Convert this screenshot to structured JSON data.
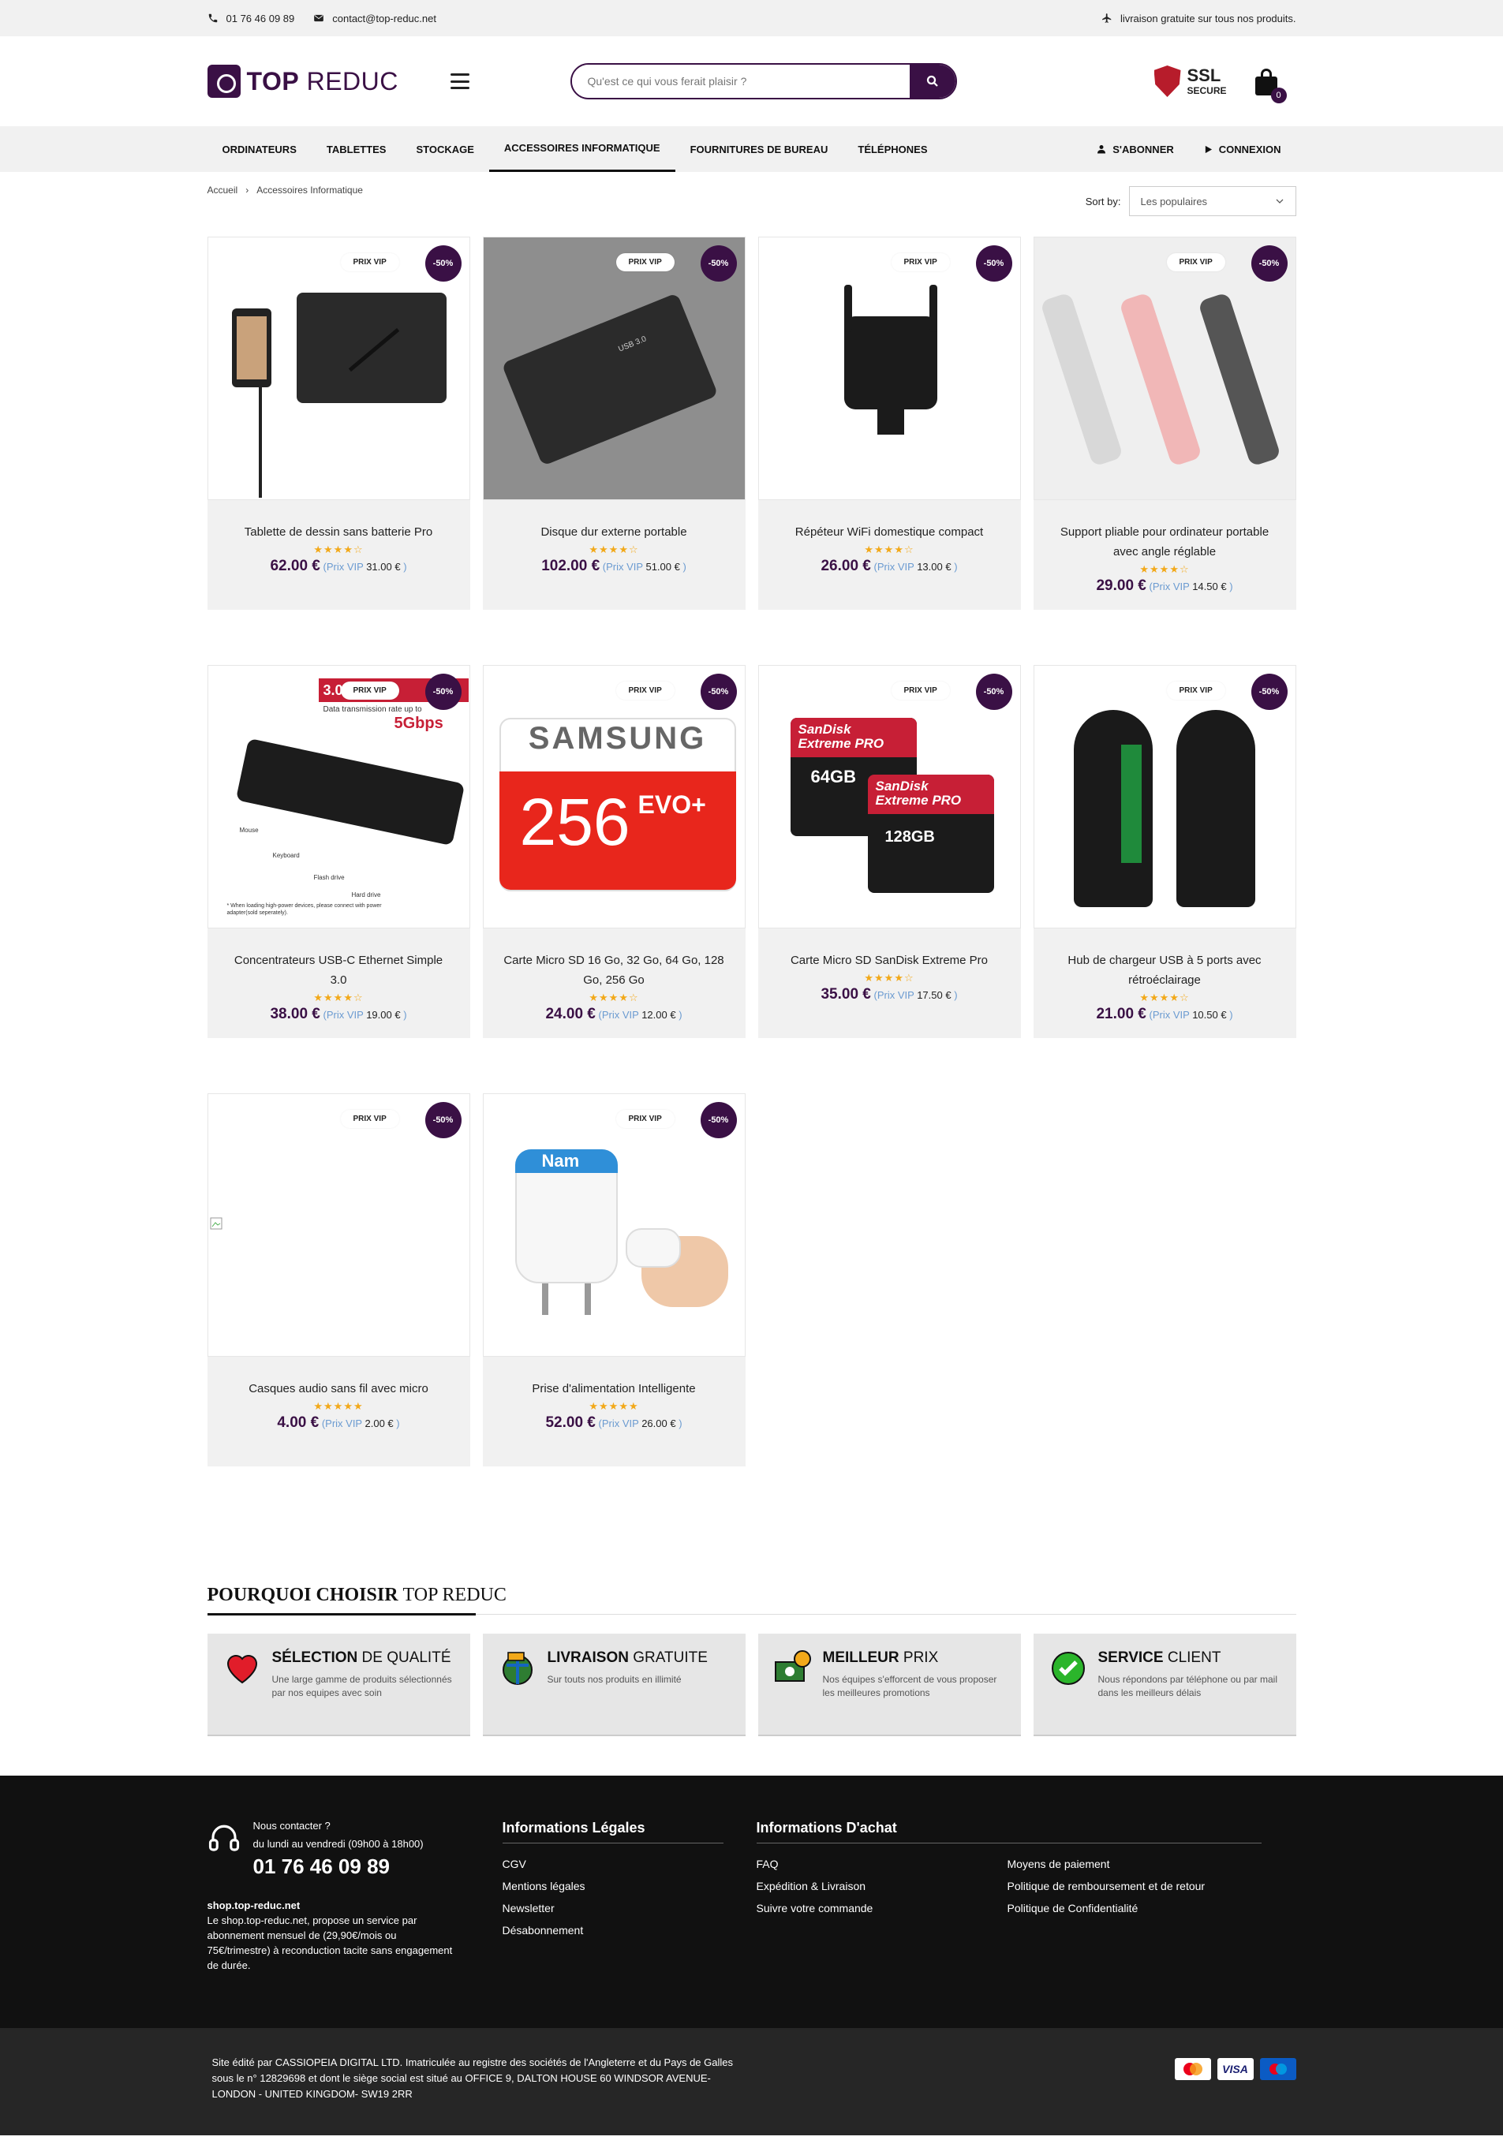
{
  "topbar": {
    "phone": "01 76 46 09 89",
    "email": "contact@top-reduc.net",
    "shipping": "livraison gratuite sur tous nos produits."
  },
  "header": {
    "logo_bold": "TOP",
    "logo_light": "REDUC",
    "search_placeholder": "Qu'est ce qui vous ferait plaisir ?",
    "ssl_title": "SSL",
    "ssl_sub": "SECURE",
    "cart_count": "0"
  },
  "nav": {
    "items": [
      "ORDINATEURS",
      "TABLETTES",
      "STOCKAGE",
      "ACCESSOIRES INFORMATIQUE",
      "FOURNITURES DE BUREAU",
      "TÉLÉPHONES"
    ],
    "active": "ACCESSOIRES INFORMATIQUE",
    "subscribe": "S'ABONNER",
    "login": "CONNEXION"
  },
  "breadcrumb": {
    "home": "Accueil",
    "current": "Accessoires Informatique"
  },
  "sort": {
    "label": "Sort by:",
    "value": "Les populaires"
  },
  "badges": {
    "vip": "PRIX VIP",
    "discount": "-50%"
  },
  "products": [
    {
      "name": "Tablette de dessin sans batterie Pro",
      "price": "62.00 €",
      "vip_label": "(Prix VIP",
      "vip_price": "31.00 €",
      "rating": 4
    },
    {
      "name": "Disque dur externe portable",
      "price": "102.00 €",
      "vip_label": "(Prix VIP",
      "vip_price": "51.00 €",
      "rating": 4
    },
    {
      "name": "Répéteur WiFi domestique compact",
      "price": "26.00 €",
      "vip_label": "(Prix VIP",
      "vip_price": "13.00 €",
      "rating": 4
    },
    {
      "name": "Support pliable pour ordinateur portable avec angle réglable",
      "price": "29.00 €",
      "vip_label": "(Prix VIP",
      "vip_price": "14.50 €",
      "rating": 4
    },
    {
      "name": "Concentrateurs USB-C Ethernet Simple 3.0",
      "price": "38.00 €",
      "vip_label": "(Prix VIP",
      "vip_price": "19.00 €",
      "rating": 4
    },
    {
      "name": "Carte Micro SD 16 Go, 32 Go, 64 Go, 128 Go, 256 Go",
      "price": "24.00 €",
      "vip_label": "(Prix VIP",
      "vip_price": "12.00 €",
      "rating": 4
    },
    {
      "name": "Carte Micro SD SanDisk Extreme Pro",
      "price": "35.00 €",
      "vip_label": "(Prix VIP",
      "vip_price": "17.50 €",
      "rating": 4
    },
    {
      "name": "Hub de chargeur USB à 5 ports avec rétroéclairage",
      "price": "21.00 €",
      "vip_label": "(Prix VIP",
      "vip_price": "10.50 €",
      "rating": 4
    },
    {
      "name": "Casques audio sans fil avec micro",
      "price": "4.00 €",
      "vip_label": "(Prix VIP",
      "vip_price": "2.00 €",
      "rating": 5
    },
    {
      "name": "Prise d'alimentation Intelligente",
      "price": "52.00 €",
      "vip_label": "(Prix VIP",
      "vip_price": "26.00 €",
      "rating": 5
    }
  ],
  "product_art": {
    "hub_banner": "3.0 USB 3",
    "hub_caption": "Data transmission rate up to",
    "hub_speed": "5Gbps",
    "hub_labels": [
      "Mouse",
      "Keyboard",
      "Flash drive",
      "Hard drive"
    ],
    "hub_note": "* When loading high-power devices, please connect with power adapter(sold seperately).",
    "samsung_brand": "SAMSUNG",
    "samsung_capacity": "256",
    "samsung_evo": "EVO+",
    "sandisk_brand": "SanDisk",
    "sandisk_line": "Extreme PRO",
    "sandisk_cap1": "64GB",
    "sandisk_cap2": "128GB",
    "disk_label": "USB 3.0",
    "plug_brand": "Nam"
  },
  "why": {
    "title_bold": "POURQUOI CHOISIR",
    "title_light": "TOP REDUC",
    "cards": [
      {
        "title_bold": "SÉLECTION",
        "title_light": "DE QUALITÉ",
        "text": "Une large gamme de produits sélectionnés par nos equipes avec soin"
      },
      {
        "title_bold": "LIVRAISON",
        "title_light": "GRATUITE",
        "text": "Sur touts nos produits en illimité"
      },
      {
        "title_bold": "MEILLEUR",
        "title_light": "PRIX",
        "text": "Nos équipes s'efforcent de vous proposer les meilleures promotions"
      },
      {
        "title_bold": "SERVICE",
        "title_light": "CLIENT",
        "text": "Nous répondons par téléphone ou par mail dans les meilleurs délais"
      }
    ]
  },
  "footer": {
    "contact_title": "Nous contacter ?",
    "contact_hours": "du lundi au vendredi (09h00 à 18h00)",
    "phone": "01 76 46 09 89",
    "site": "shop.top-reduc.net",
    "about": "Le shop.top-reduc.net, propose un service par abonnement mensuel de (29,90€/mois ou 75€/trimestre) à reconduction tacite sans engagement de durée.",
    "legal_title": "Informations Légales",
    "legal_links": [
      "CGV",
      "Mentions légales",
      "Newsletter",
      "Désabonnement"
    ],
    "buy_title": "Informations D'achat",
    "buy_links_left": [
      "FAQ",
      "Expédition & Livraison",
      "Suivre votre commande"
    ],
    "buy_links_right": [
      "Moyens de paiement",
      "Politique de remboursement et de retour",
      "Politique de Confidentialité"
    ],
    "legal_notice": "Site édité par CASSIOPEIA DIGITAL LTD. Imatriculée au registre des sociétés de l'Angleterre et du Pays de Galles sous le n° 12829698 et dont le siège social est situé au OFFICE 9, DALTON HOUSE 60 WINDSOR AVENUE- LONDON - UNITED KINGDOM- SW19 2RR",
    "payment": [
      "MasterCard",
      "VISA",
      "Maestro"
    ]
  },
  "colors": {
    "brand": "#3a1045",
    "star": "#f2a91a",
    "vip": "#6b9bd1"
  }
}
